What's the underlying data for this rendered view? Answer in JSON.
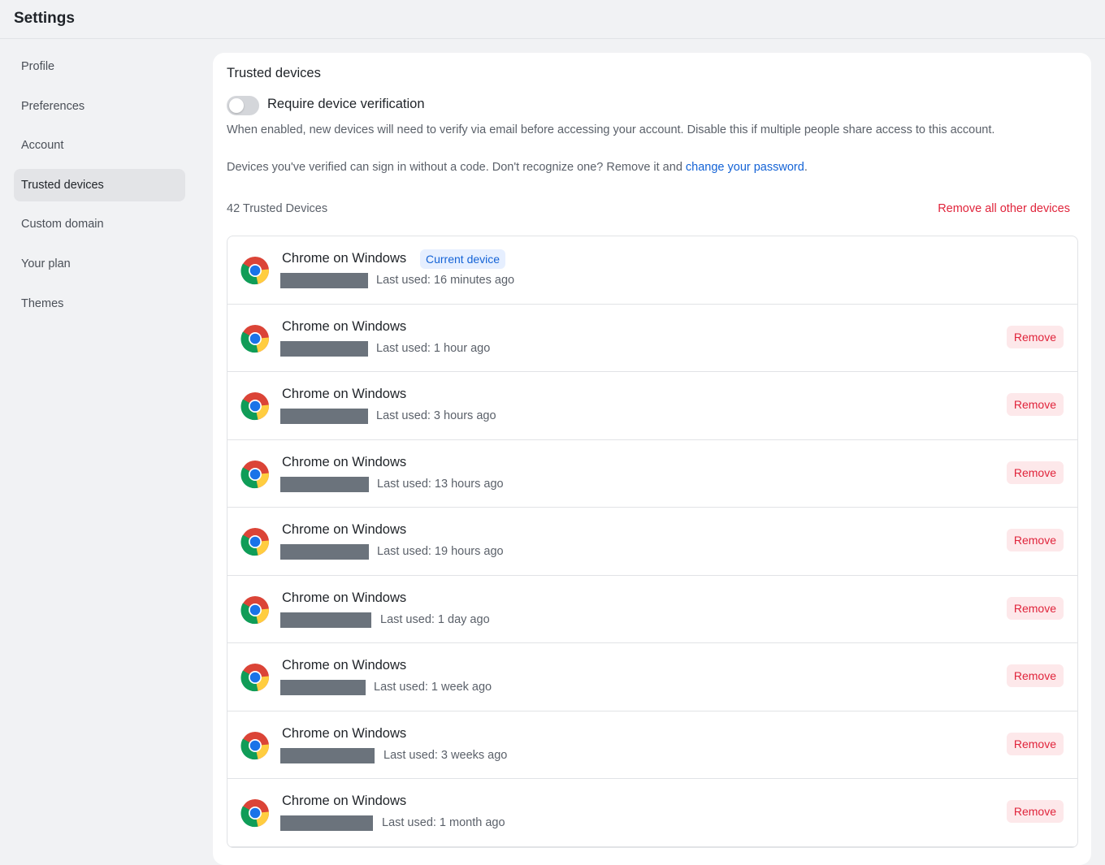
{
  "header": {
    "title": "Settings"
  },
  "sidebar": {
    "items": [
      {
        "label": "Profile"
      },
      {
        "label": "Preferences"
      },
      {
        "label": "Account"
      },
      {
        "label": "Trusted devices",
        "active": true
      },
      {
        "label": "Custom domain"
      },
      {
        "label": "Your plan"
      },
      {
        "label": "Themes"
      }
    ]
  },
  "main": {
    "title": "Trusted devices",
    "toggle": {
      "label": "Require device verification",
      "enabled": false
    },
    "description": "When enabled, new devices will need to verify via email before accessing your account. Disable this if multiple people share access to this account.",
    "info_text": "Devices you've verified can sign in without a code. Don't recognize one? Remove it and ",
    "info_link": "change your password",
    "info_end": ".",
    "count_label": "42 Trusted Devices",
    "remove_all_label": "Remove all other devices",
    "current_badge": "Current device",
    "remove_label": "Remove",
    "devices": [
      {
        "name": "Chrome on Windows",
        "last_used": "Last used: 16 minutes ago",
        "current": true,
        "icon": "chrome-icon"
      },
      {
        "name": "Chrome on Windows",
        "last_used": "Last used: 1 hour ago",
        "icon": "chrome-icon"
      },
      {
        "name": "Chrome on Windows",
        "last_used": "Last used: 3 hours ago",
        "icon": "chrome-icon"
      },
      {
        "name": "Chrome on Windows",
        "last_used": "Last used: 13 hours ago",
        "icon": "chrome-icon"
      },
      {
        "name": "Chrome on Windows",
        "last_used": "Last used: 19 hours ago",
        "icon": "chrome-icon"
      },
      {
        "name": "Chrome on Windows",
        "last_used": "Last used: 1 day ago",
        "icon": "chrome-icon"
      },
      {
        "name": "Chrome on Windows",
        "last_used": "Last used: 1 week ago",
        "icon": "chrome-icon"
      },
      {
        "name": "Chrome on Windows",
        "last_used": "Last used: 3 weeks ago",
        "icon": "chrome-icon"
      },
      {
        "name": "Chrome on Windows",
        "last_used": "Last used: 1 month ago",
        "icon": "chrome-icon"
      }
    ]
  },
  "colors": {
    "accent": "#1463d6",
    "danger": "#e0243b",
    "danger_bg": "#fde8ea",
    "badge_bg": "#e6efff",
    "redaction": "#6b737c"
  }
}
